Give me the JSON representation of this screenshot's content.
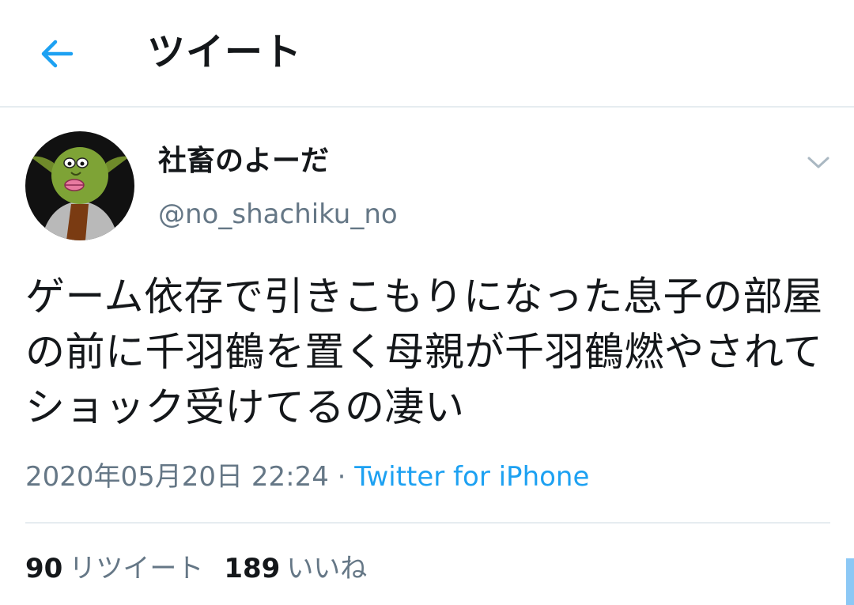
{
  "header": {
    "title": "ツイート",
    "back_icon": "arrow-left-icon"
  },
  "tweet": {
    "display_name": "社畜のよーだ",
    "handle": "@no_shachiku_no",
    "text": "ゲーム依存で引きこもりになった息子の部屋の前に千羽鶴を置く母親が千羽鶴燃やされてショック受けてるの凄い",
    "timestamp": "2020年05月20日 22:24",
    "separator": " · ",
    "source": "Twitter for iPhone",
    "caret_icon": "chevron-down-icon"
  },
  "stats": {
    "retweets_count": "90",
    "retweets_label": "リツイート",
    "likes_count": "189",
    "likes_label": "いいね"
  },
  "colors": {
    "accent": "#1da1f2",
    "text": "#14171a",
    "muted": "#657786",
    "divider": "#e6ecf0"
  }
}
